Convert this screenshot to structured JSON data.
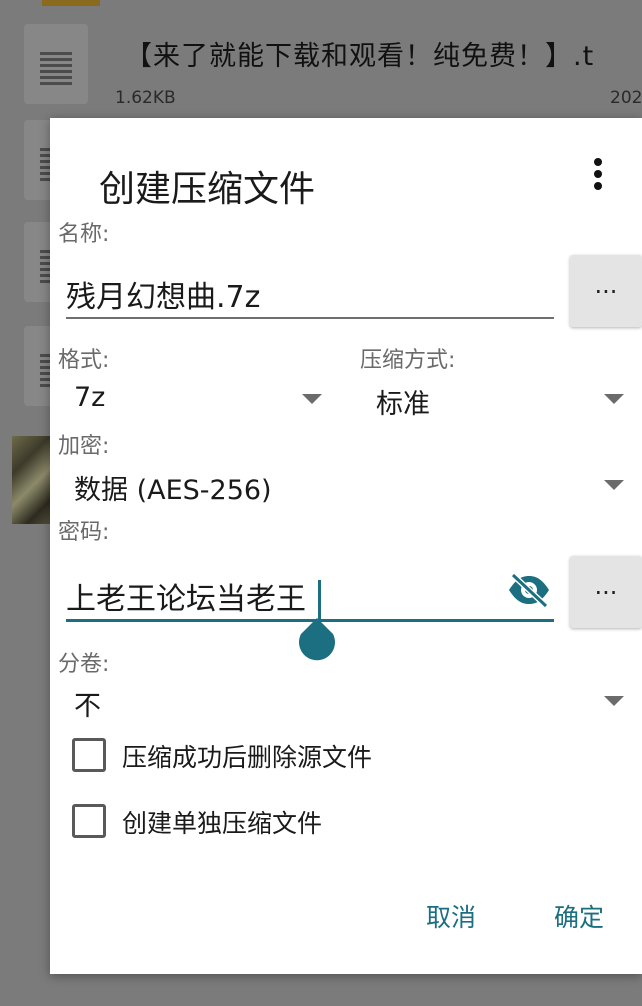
{
  "background": {
    "file": {
      "name": "【来了就能下载和观看！纯免费！】.t",
      "size": "1.62KB",
      "date": "202"
    },
    "icons": [
      "document-icon",
      "document-icon",
      "document-icon",
      "document-icon",
      "image-thumbnail"
    ]
  },
  "dialog": {
    "title": "创建压缩文件",
    "name": {
      "label": "名称:",
      "value": "残月幻想曲.7z",
      "browse_label": "..."
    },
    "format": {
      "label": "格式:",
      "value": "7z"
    },
    "compression": {
      "label": "压缩方式:",
      "value": "标准"
    },
    "encryption": {
      "label": "加密:",
      "value": "数据 (AES-256)"
    },
    "password": {
      "label": "密码:",
      "value": "上老王论坛当老王",
      "browse_label": "..."
    },
    "volume": {
      "label": "分卷:",
      "value": "不"
    },
    "options": [
      {
        "label": "压缩成功后删除源文件",
        "checked": false
      },
      {
        "label": "创建单独压缩文件",
        "checked": false
      }
    ],
    "buttons": {
      "cancel": "取消",
      "ok": "确定"
    }
  },
  "colors": {
    "accent": "#1b6f80",
    "scrim": "#7b7b7b",
    "dialog_bg": "#ffffff"
  }
}
